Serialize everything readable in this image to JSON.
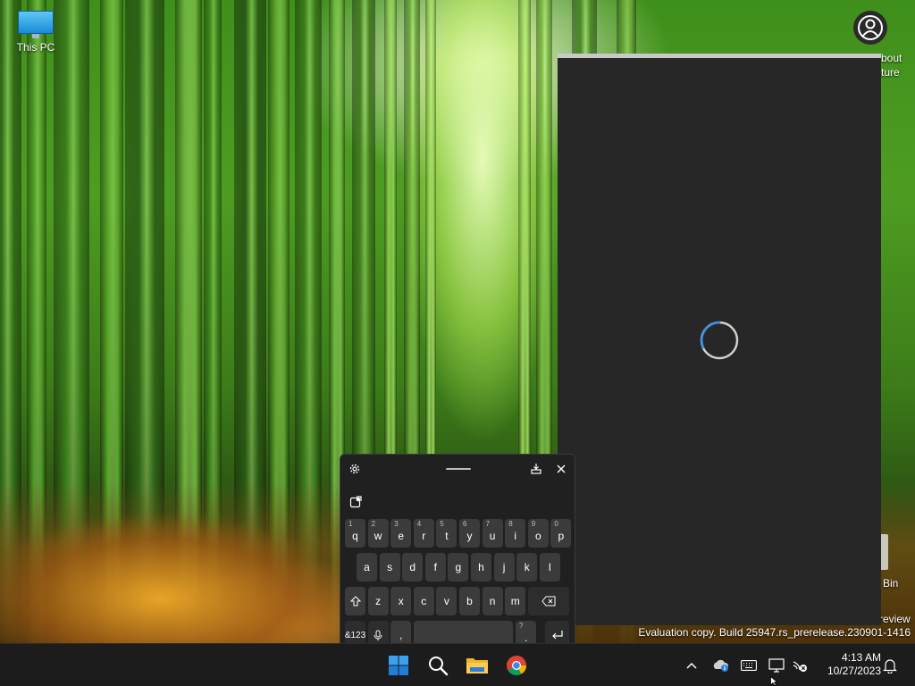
{
  "desktop": {
    "icons": [
      {
        "label": "This PC"
      }
    ],
    "partial_labels": {
      "about": "bout",
      "ture": "ture",
      "bin": "Bin",
      "review": "review"
    },
    "watermark": "Evaluation copy. Build 25947.rs_prerelease.230901-1416"
  },
  "app_window": {
    "state": "loading"
  },
  "touch_keyboard": {
    "header": {
      "settings_icon": "gear-icon",
      "dock_icon": "dock-icon",
      "close_icon": "close-icon"
    },
    "toolbar": {
      "clipboard_icon": "clipboard-icon"
    },
    "rows": [
      [
        {
          "hint": "1",
          "char": "q"
        },
        {
          "hint": "2",
          "char": "w"
        },
        {
          "hint": "3",
          "char": "e"
        },
        {
          "hint": "4",
          "char": "r"
        },
        {
          "hint": "5",
          "char": "t"
        },
        {
          "hint": "6",
          "char": "y"
        },
        {
          "hint": "7",
          "char": "u"
        },
        {
          "hint": "8",
          "char": "i"
        },
        {
          "hint": "9",
          "char": "o"
        },
        {
          "hint": "0",
          "char": "p"
        }
      ],
      [
        {
          "char": "a"
        },
        {
          "char": "s"
        },
        {
          "char": "d"
        },
        {
          "char": "f"
        },
        {
          "char": "g"
        },
        {
          "char": "h"
        },
        {
          "char": "j"
        },
        {
          "char": "k"
        },
        {
          "char": "l"
        }
      ],
      [
        {
          "char": "z"
        },
        {
          "char": "x"
        },
        {
          "char": "c"
        },
        {
          "char": "v"
        },
        {
          "char": "b"
        },
        {
          "char": "n"
        },
        {
          "char": "m"
        }
      ]
    ],
    "bottom_row": {
      "symbols_label": "&123",
      "comma": ",",
      "period_hint": "?",
      "period": "."
    }
  },
  "taskbar": {
    "apps": [
      "start",
      "search",
      "file-explorer",
      "chrome"
    ],
    "clock": {
      "time": "4:13 AM",
      "date": "10/27/2023"
    }
  }
}
